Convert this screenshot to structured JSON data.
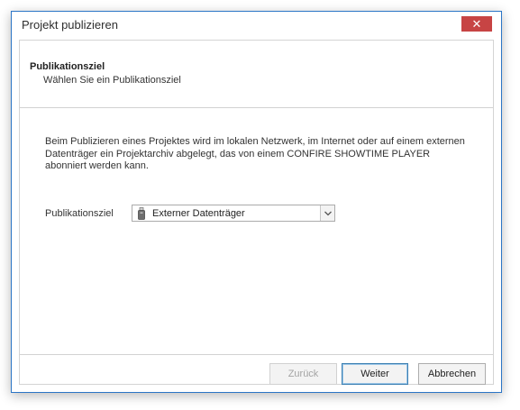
{
  "window": {
    "title": "Projekt publizieren",
    "close_glyph": "✕"
  },
  "header": {
    "title": "Publikationsziel",
    "subtitle": "Wählen Sie ein Publikationsziel"
  },
  "description": {
    "line1": "Beim Publizieren eines Projektes wird im lokalen Netzwerk, im Internet oder auf einem externen",
    "line2": "Datenträger ein Projektarchiv abgelegt, das von einem CONFIRE SHOWTIME PLAYER",
    "line3": "abonniert werden kann."
  },
  "field": {
    "label": "Publikationsziel",
    "value": "Externer Datenträger",
    "icon": "usb-drive-icon"
  },
  "buttons": {
    "back": "Zurück",
    "next": "Weiter",
    "cancel": "Abbrechen"
  },
  "colors": {
    "close_button": "#c74444",
    "window_border": "#2b75c6",
    "default_button_border": "#3c7fb1"
  }
}
